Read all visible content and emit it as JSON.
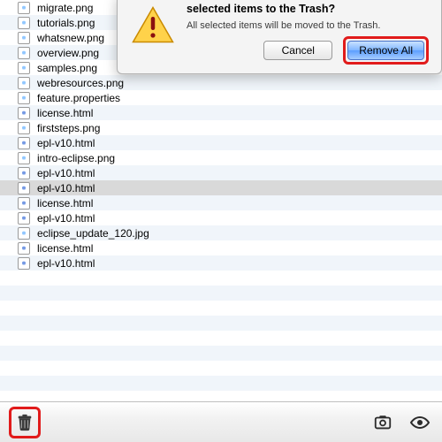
{
  "dialog": {
    "title": "selected items to the Trash?",
    "subtitle": "All selected items will be moved to the Trash.",
    "cancel_label": "Cancel",
    "confirm_label": "Remove All"
  },
  "files": [
    {
      "name": "migrate.png",
      "kind": "png"
    },
    {
      "name": "tutorials.png",
      "kind": "png"
    },
    {
      "name": "whatsnew.png",
      "kind": "png"
    },
    {
      "name": "overview.png",
      "kind": "png"
    },
    {
      "name": "samples.png",
      "kind": "png"
    },
    {
      "name": "webresources.png",
      "kind": "png"
    },
    {
      "name": "feature.properties",
      "kind": "text"
    },
    {
      "name": "license.html",
      "kind": "html"
    },
    {
      "name": "firststeps.png",
      "kind": "png"
    },
    {
      "name": "epl-v10.html",
      "kind": "html"
    },
    {
      "name": "intro-eclipse.png",
      "kind": "png"
    },
    {
      "name": "epl-v10.html",
      "kind": "html"
    },
    {
      "name": "epl-v10.html",
      "kind": "html",
      "selected": true
    },
    {
      "name": "license.html",
      "kind": "html"
    },
    {
      "name": "epl-v10.html",
      "kind": "html"
    },
    {
      "name": "eclipse_update_120.jpg",
      "kind": "jpg"
    },
    {
      "name": "license.html",
      "kind": "html"
    },
    {
      "name": "epl-v10.html",
      "kind": "html"
    }
  ],
  "colors": {
    "highlight": "#e11b1b",
    "primary_button": "#7fb6ff"
  },
  "toolbar": {
    "trash_icon": "trash-icon",
    "target_icon": "target-icon",
    "eye_icon": "eye-icon"
  }
}
